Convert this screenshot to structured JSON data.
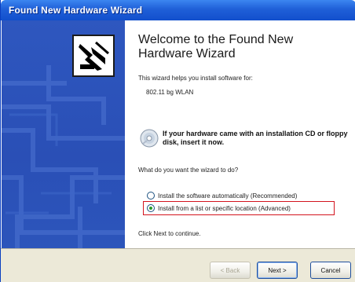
{
  "window": {
    "title": "Found New Hardware Wizard"
  },
  "wizard": {
    "heading": "Welcome to the Found New Hardware Wizard",
    "intro": "This wizard helps you install software for:",
    "device": "802.11 bg WLAN",
    "cd_prompt": "If your hardware came with an installation CD or floppy disk, insert it now.",
    "question": "What do you want the wizard to do?",
    "options": [
      {
        "label": "Install the software automatically (Recommended)",
        "selected": false
      },
      {
        "label": "Install from a list or specific location (Advanced)",
        "selected": true
      }
    ],
    "continue_text": "Click Next to continue."
  },
  "buttons": {
    "back": "< Back",
    "next": "Next >",
    "cancel": "Cancel"
  },
  "icons": {
    "wizard": "hardware-wizard-icon",
    "cd": "cd-icon"
  },
  "colors": {
    "titlebar": "#1f5fd8",
    "sidebar": "#2a4fb6",
    "highlight": "#d3141e",
    "footer": "#ece9d8"
  }
}
